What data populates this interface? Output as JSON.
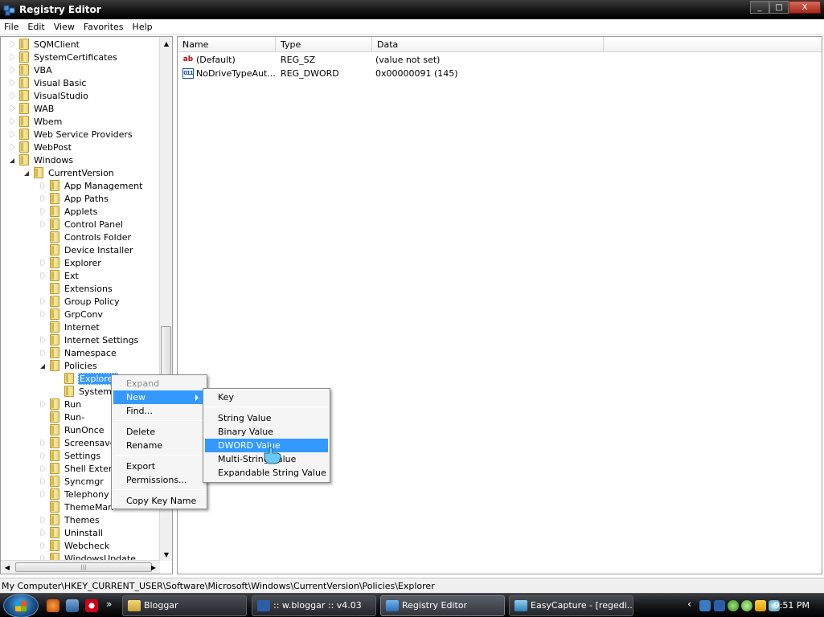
{
  "window": {
    "title": "Registry Editor",
    "controls": [
      "_",
      "□",
      "X"
    ]
  },
  "menu": [
    "File",
    "Edit",
    "View",
    "Favorites",
    "Help"
  ],
  "tree": [
    {
      "label": "SQMClient",
      "depth": 1,
      "state": "collapsed"
    },
    {
      "label": "SystemCertificates",
      "depth": 1,
      "state": "collapsed"
    },
    {
      "label": "VBA",
      "depth": 1,
      "state": "collapsed"
    },
    {
      "label": "Visual Basic",
      "depth": 1,
      "state": "collapsed"
    },
    {
      "label": "VisualStudio",
      "depth": 1,
      "state": "collapsed"
    },
    {
      "label": "WAB",
      "depth": 1,
      "state": "collapsed"
    },
    {
      "label": "Wbem",
      "depth": 1,
      "state": "collapsed"
    },
    {
      "label": "Web Service Providers",
      "depth": 1,
      "state": "collapsed"
    },
    {
      "label": "WebPost",
      "depth": 1,
      "state": "collapsed"
    },
    {
      "label": "Windows",
      "depth": 1,
      "state": "expanded"
    },
    {
      "label": "CurrentVersion",
      "depth": 2,
      "state": "expanded"
    },
    {
      "label": "App Management",
      "depth": 3,
      "state": "collapsed"
    },
    {
      "label": "App Paths",
      "depth": 3,
      "state": "collapsed"
    },
    {
      "label": "Applets",
      "depth": 3,
      "state": "collapsed"
    },
    {
      "label": "Control Panel",
      "depth": 3,
      "state": "collapsed"
    },
    {
      "label": "Controls Folder",
      "depth": 3,
      "state": "none"
    },
    {
      "label": "Device Installer",
      "depth": 3,
      "state": "none"
    },
    {
      "label": "Explorer",
      "depth": 3,
      "state": "collapsed"
    },
    {
      "label": "Ext",
      "depth": 3,
      "state": "collapsed"
    },
    {
      "label": "Extensions",
      "depth": 3,
      "state": "none"
    },
    {
      "label": "Group Policy",
      "depth": 3,
      "state": "collapsed"
    },
    {
      "label": "GrpConv",
      "depth": 3,
      "state": "collapsed"
    },
    {
      "label": "Internet",
      "depth": 3,
      "state": "none"
    },
    {
      "label": "Internet Settings",
      "depth": 3,
      "state": "collapsed"
    },
    {
      "label": "Namespace",
      "depth": 3,
      "state": "collapsed"
    },
    {
      "label": "Policies",
      "depth": 3,
      "state": "expanded"
    },
    {
      "label": "Explorer",
      "depth": 4,
      "state": "none",
      "selected": true
    },
    {
      "label": "System",
      "depth": 4,
      "state": "none"
    },
    {
      "label": "Run",
      "depth": 3,
      "state": "collapsed"
    },
    {
      "label": "Run-",
      "depth": 3,
      "state": "none"
    },
    {
      "label": "RunOnce",
      "depth": 3,
      "state": "none"
    },
    {
      "label": "Screensave",
      "depth": 3,
      "state": "collapsed"
    },
    {
      "label": "Settings",
      "depth": 3,
      "state": "collapsed"
    },
    {
      "label": "Shell Exten",
      "depth": 3,
      "state": "collapsed"
    },
    {
      "label": "Syncmgr",
      "depth": 3,
      "state": "collapsed"
    },
    {
      "label": "Telephony",
      "depth": 3,
      "state": "collapsed"
    },
    {
      "label": "ThemeMan",
      "depth": 3,
      "state": "none"
    },
    {
      "label": "Themes",
      "depth": 3,
      "state": "collapsed"
    },
    {
      "label": "Uninstall",
      "depth": 3,
      "state": "collapsed"
    },
    {
      "label": "Webcheck",
      "depth": 3,
      "state": "collapsed"
    },
    {
      "label": "WindowsUpdate",
      "depth": 3,
      "state": "collapsed"
    }
  ],
  "list": {
    "columns": [
      "Name",
      "Type",
      "Data"
    ],
    "rows": [
      {
        "icon": "string-value-icon",
        "glyph": "ab",
        "name": "(Default)",
        "type": "REG_SZ",
        "data": "(value not set)"
      },
      {
        "icon": "dword-value-icon",
        "glyph": "011",
        "name": "NoDriveTypeAut...",
        "type": "REG_DWORD",
        "data": "0x00000091 (145)"
      }
    ]
  },
  "context_menu": {
    "items": [
      {
        "label": "Expand",
        "disabled": true
      },
      {
        "label": "New",
        "highlighted": true,
        "submenu": true
      },
      {
        "label": "Find..."
      },
      {
        "sep": true
      },
      {
        "label": "Delete"
      },
      {
        "label": "Rename"
      },
      {
        "sep": true
      },
      {
        "label": "Export"
      },
      {
        "label": "Permissions..."
      },
      {
        "sep": true
      },
      {
        "label": "Copy Key Name"
      }
    ]
  },
  "new_submenu": {
    "items": [
      {
        "label": "Key"
      },
      {
        "sep": true
      },
      {
        "label": "String Value"
      },
      {
        "label": "Binary Value"
      },
      {
        "label": "DWORD Value",
        "highlighted": true
      },
      {
        "label": "Multi-String Value"
      },
      {
        "label": "Expandable String Value"
      }
    ]
  },
  "status": "My Computer\\HKEY_CURRENT_USER\\Software\\Microsoft\\Windows\\CurrentVersion\\Policies\\Explorer",
  "taskbar": {
    "quicklaunch_more": "»",
    "tasks": [
      {
        "label": "Bloggar",
        "icon": "folder-icon"
      },
      {
        "label": ":: w.bloggar :: v4.03",
        "icon": "wbloggar-icon"
      },
      {
        "label": "Registry Editor",
        "icon": "regedit-icon",
        "active": true
      },
      {
        "label": "EasyCapture - [regedi...",
        "icon": "easycapture-icon"
      }
    ],
    "tray_expand": "‹",
    "clock": "9:51 PM"
  }
}
